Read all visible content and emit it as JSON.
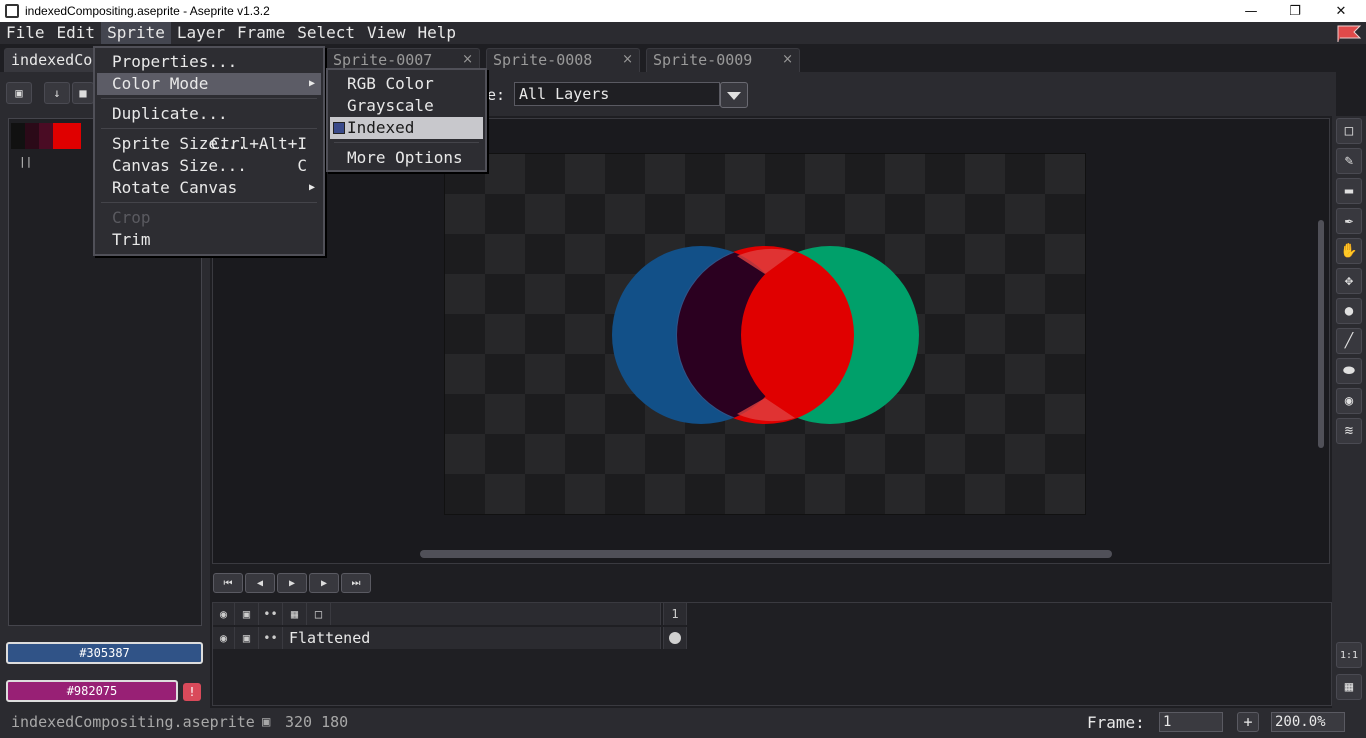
{
  "window": {
    "title": "indexedCompositing.aseprite - Aseprite v1.3.2",
    "min_glyph": "—",
    "max_glyph": "❐",
    "close_glyph": "✕"
  },
  "menubar": {
    "items": [
      "File",
      "Edit",
      "Sprite",
      "Layer",
      "Frame",
      "Select",
      "View",
      "Help"
    ],
    "active": "Sprite"
  },
  "tabs": [
    {
      "label": "indexedCo",
      "active": true
    },
    {
      "label": "Sprite-0007",
      "close": "×"
    },
    {
      "label": "Sprite-0008",
      "close": "×"
    },
    {
      "label": "Sprite-0009",
      "close": "×"
    }
  ],
  "sprite_menu": {
    "properties": "Properties...",
    "color_mode": "Color Mode",
    "duplicate": "Duplicate...",
    "sprite_size": "Sprite Size...",
    "sprite_size_shortcut": "Ctrl+Alt+I",
    "canvas_size": "Canvas Size...",
    "canvas_size_shortcut": "C",
    "rotate_canvas": "Rotate Canvas",
    "crop": "Crop",
    "trim": "Trim"
  },
  "color_mode_menu": {
    "rgb": "RGB Color",
    "grayscale": "Grayscale",
    "indexed": "Indexed",
    "more_options": "More Options"
  },
  "context_bar": {
    "select_label": "e:",
    "select_value": "All Layers"
  },
  "palette": {
    "swatches": [
      "#111111",
      "#2b0a18",
      "#4a0c24",
      "#e00000"
    ]
  },
  "colors": {
    "foreground": "#305387",
    "background": "#982075",
    "fg_color": "#305387",
    "bg_color": "#982075",
    "warning_glyph": "!"
  },
  "timeline": {
    "frame_number": "1",
    "layer_name": "Flattened"
  },
  "status": {
    "filename": "indexedCompositing.aseprite",
    "dimensions": "320 180",
    "frame_label": "Frame:",
    "frame_value": "1",
    "plus": "+",
    "zoom": "200.0%",
    "one_to_one": "1:1"
  }
}
